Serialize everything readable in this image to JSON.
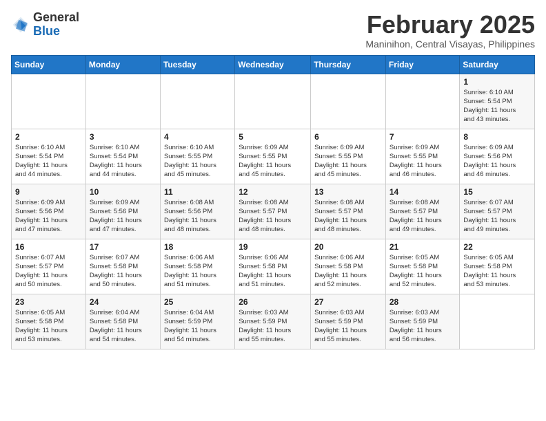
{
  "header": {
    "logo_general": "General",
    "logo_blue": "Blue",
    "month_year": "February 2025",
    "location": "Maninihon, Central Visayas, Philippines"
  },
  "days_of_week": [
    "Sunday",
    "Monday",
    "Tuesday",
    "Wednesday",
    "Thursday",
    "Friday",
    "Saturday"
  ],
  "weeks": [
    [
      {
        "day": "",
        "info": ""
      },
      {
        "day": "",
        "info": ""
      },
      {
        "day": "",
        "info": ""
      },
      {
        "day": "",
        "info": ""
      },
      {
        "day": "",
        "info": ""
      },
      {
        "day": "",
        "info": ""
      },
      {
        "day": "1",
        "info": "Sunrise: 6:10 AM\nSunset: 5:54 PM\nDaylight: 11 hours\nand 43 minutes."
      }
    ],
    [
      {
        "day": "2",
        "info": "Sunrise: 6:10 AM\nSunset: 5:54 PM\nDaylight: 11 hours\nand 44 minutes."
      },
      {
        "day": "3",
        "info": "Sunrise: 6:10 AM\nSunset: 5:54 PM\nDaylight: 11 hours\nand 44 minutes."
      },
      {
        "day": "4",
        "info": "Sunrise: 6:10 AM\nSunset: 5:55 PM\nDaylight: 11 hours\nand 45 minutes."
      },
      {
        "day": "5",
        "info": "Sunrise: 6:09 AM\nSunset: 5:55 PM\nDaylight: 11 hours\nand 45 minutes."
      },
      {
        "day": "6",
        "info": "Sunrise: 6:09 AM\nSunset: 5:55 PM\nDaylight: 11 hours\nand 45 minutes."
      },
      {
        "day": "7",
        "info": "Sunrise: 6:09 AM\nSunset: 5:55 PM\nDaylight: 11 hours\nand 46 minutes."
      },
      {
        "day": "8",
        "info": "Sunrise: 6:09 AM\nSunset: 5:56 PM\nDaylight: 11 hours\nand 46 minutes."
      }
    ],
    [
      {
        "day": "9",
        "info": "Sunrise: 6:09 AM\nSunset: 5:56 PM\nDaylight: 11 hours\nand 47 minutes."
      },
      {
        "day": "10",
        "info": "Sunrise: 6:09 AM\nSunset: 5:56 PM\nDaylight: 11 hours\nand 47 minutes."
      },
      {
        "day": "11",
        "info": "Sunrise: 6:08 AM\nSunset: 5:56 PM\nDaylight: 11 hours\nand 48 minutes."
      },
      {
        "day": "12",
        "info": "Sunrise: 6:08 AM\nSunset: 5:57 PM\nDaylight: 11 hours\nand 48 minutes."
      },
      {
        "day": "13",
        "info": "Sunrise: 6:08 AM\nSunset: 5:57 PM\nDaylight: 11 hours\nand 48 minutes."
      },
      {
        "day": "14",
        "info": "Sunrise: 6:08 AM\nSunset: 5:57 PM\nDaylight: 11 hours\nand 49 minutes."
      },
      {
        "day": "15",
        "info": "Sunrise: 6:07 AM\nSunset: 5:57 PM\nDaylight: 11 hours\nand 49 minutes."
      }
    ],
    [
      {
        "day": "16",
        "info": "Sunrise: 6:07 AM\nSunset: 5:57 PM\nDaylight: 11 hours\nand 50 minutes."
      },
      {
        "day": "17",
        "info": "Sunrise: 6:07 AM\nSunset: 5:58 PM\nDaylight: 11 hours\nand 50 minutes."
      },
      {
        "day": "18",
        "info": "Sunrise: 6:06 AM\nSunset: 5:58 PM\nDaylight: 11 hours\nand 51 minutes."
      },
      {
        "day": "19",
        "info": "Sunrise: 6:06 AM\nSunset: 5:58 PM\nDaylight: 11 hours\nand 51 minutes."
      },
      {
        "day": "20",
        "info": "Sunrise: 6:06 AM\nSunset: 5:58 PM\nDaylight: 11 hours\nand 52 minutes."
      },
      {
        "day": "21",
        "info": "Sunrise: 6:05 AM\nSunset: 5:58 PM\nDaylight: 11 hours\nand 52 minutes."
      },
      {
        "day": "22",
        "info": "Sunrise: 6:05 AM\nSunset: 5:58 PM\nDaylight: 11 hours\nand 53 minutes."
      }
    ],
    [
      {
        "day": "23",
        "info": "Sunrise: 6:05 AM\nSunset: 5:58 PM\nDaylight: 11 hours\nand 53 minutes."
      },
      {
        "day": "24",
        "info": "Sunrise: 6:04 AM\nSunset: 5:58 PM\nDaylight: 11 hours\nand 54 minutes."
      },
      {
        "day": "25",
        "info": "Sunrise: 6:04 AM\nSunset: 5:59 PM\nDaylight: 11 hours\nand 54 minutes."
      },
      {
        "day": "26",
        "info": "Sunrise: 6:03 AM\nSunset: 5:59 PM\nDaylight: 11 hours\nand 55 minutes."
      },
      {
        "day": "27",
        "info": "Sunrise: 6:03 AM\nSunset: 5:59 PM\nDaylight: 11 hours\nand 55 minutes."
      },
      {
        "day": "28",
        "info": "Sunrise: 6:03 AM\nSunset: 5:59 PM\nDaylight: 11 hours\nand 56 minutes."
      },
      {
        "day": "",
        "info": ""
      }
    ]
  ]
}
